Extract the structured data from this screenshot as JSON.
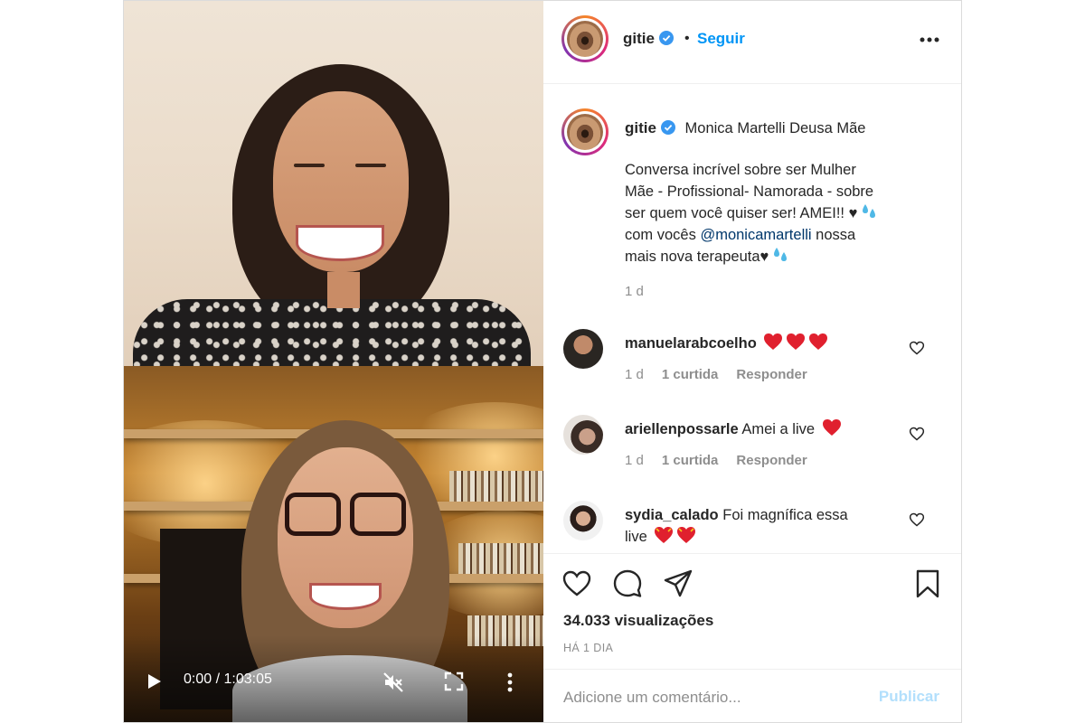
{
  "video": {
    "time": "0:00 / 1:03:05"
  },
  "header": {
    "username": "gitie",
    "separator": "•",
    "follow_label": "Seguir"
  },
  "caption": {
    "username": "gitie",
    "title": "Monica Martelli Deusa Mãe",
    "line1": "Conversa incrível sobre ser Mulher",
    "line2": "Mãe - Profissional- Namorada - sobre",
    "line3": "ser quem você quiser ser! AMEI!! ♥",
    "line4_pre": "com vocês ",
    "mention": "@monicamartelli",
    "line4_post": " nossa",
    "line5": "mais nova terapeuta♥",
    "age": "1 d"
  },
  "comments": [
    {
      "username": "manuelarabcoelho",
      "text": "",
      "hearts": 3,
      "age": "1 d",
      "likes": "1 curtida",
      "reply": "Responder"
    },
    {
      "username": "ariellenpossarle",
      "text": "Amei a live",
      "hearts": 1,
      "age": "1 d",
      "likes": "1 curtida",
      "reply": "Responder"
    },
    {
      "username": "sydia_calado",
      "text": "Foi magnífica essa",
      "text2": "live",
      "hearts": 2
    }
  ],
  "actions": {
    "views": "34.033 visualizações",
    "posted": "HÁ 1 DIA"
  },
  "add_comment": {
    "placeholder": "Adicione um comentário...",
    "publish_label": "Publicar"
  },
  "colors": {
    "accent": "#0095f6",
    "publish_disabled": "#b2dffc",
    "heart_red": "#ed4956",
    "mention": "#00376b"
  }
}
